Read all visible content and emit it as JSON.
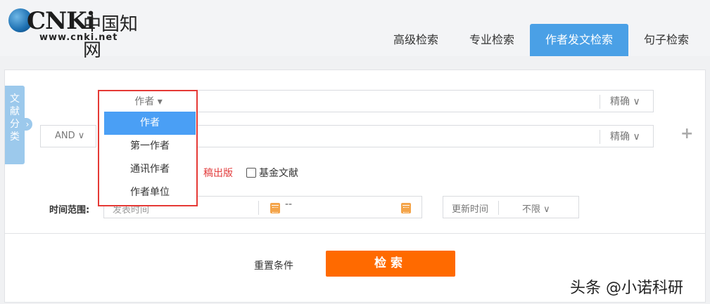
{
  "header": {
    "logo_brand": "CNKi",
    "logo_brand_cn": "中国知网",
    "logo_url": "www.cnki.net",
    "tabs": [
      {
        "label": "高级检索"
      },
      {
        "label": "专业检索"
      },
      {
        "label": "作者发文检索",
        "active": true
      },
      {
        "label": "句子检索"
      }
    ]
  },
  "side_tab": {
    "label": "文献分类"
  },
  "search": {
    "row1": {
      "field": "作者",
      "match": "精确"
    },
    "row2": {
      "logic": "AND",
      "match": "精确"
    },
    "options": {
      "first_release_partial": "稿出版",
      "fund_label": "基金文献"
    },
    "time_label": "时间范围:",
    "date_start_partial": "发表时间",
    "date_separator": "--",
    "update_label": "更新时间",
    "update_value": "不限",
    "reset_label": "重置条件",
    "search_label": "检索"
  },
  "dropdown": {
    "items": [
      "作者",
      "第一作者",
      "通讯作者",
      "作者单位"
    ],
    "selected_index": 0
  },
  "watermark": "头条 @小诺科研",
  "colors": {
    "accent": "#4aa0e6",
    "search_button": "#ff6a00",
    "highlight_border": "#e53935"
  }
}
